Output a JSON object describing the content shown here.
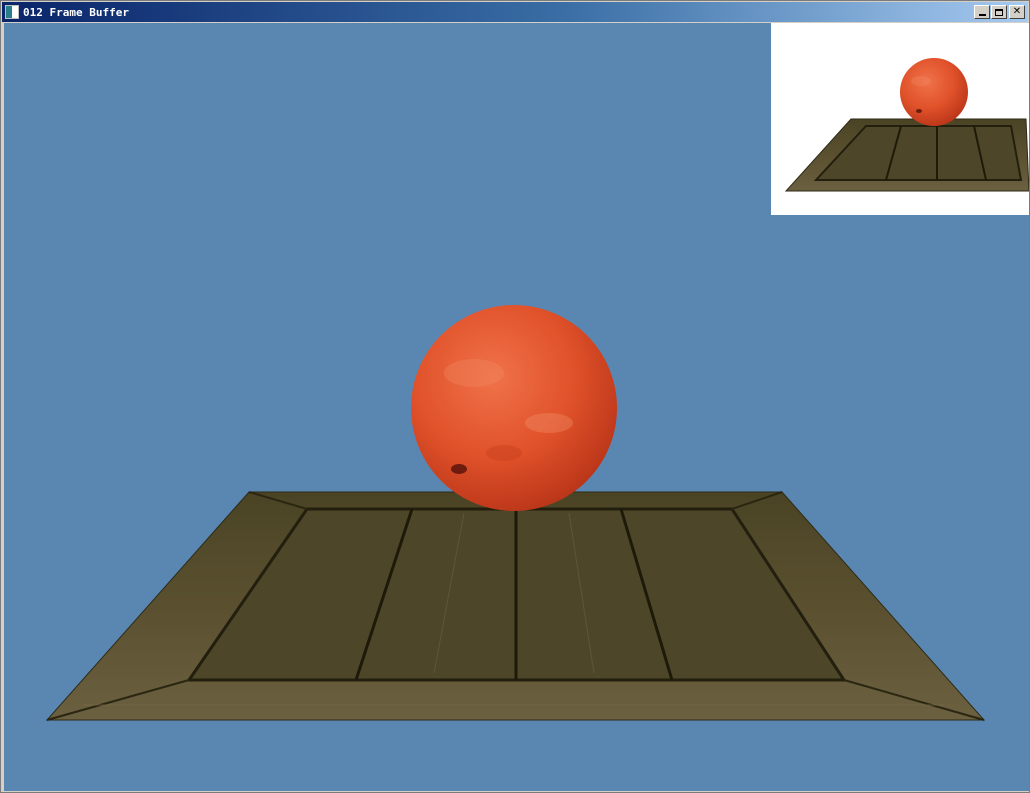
{
  "window": {
    "title": "012 Frame Buffer",
    "controls": {
      "minimize": "minimize",
      "maximize": "maximize",
      "close": "close"
    }
  },
  "colors": {
    "clear_color": "#5a87b2",
    "inset_background": "#ffffff",
    "sphere": "#e0522a",
    "wood": "#5a5030"
  },
  "icons": {
    "app": "app-icon",
    "minimize": "minimize-icon",
    "maximize": "maximize-icon",
    "close": "close-icon"
  }
}
